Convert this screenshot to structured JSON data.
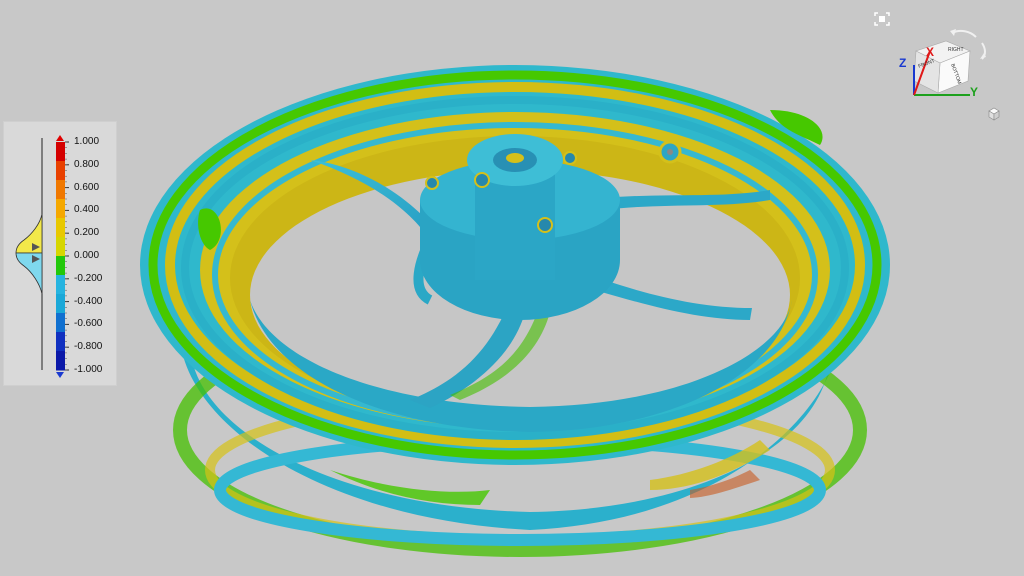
{
  "legend": {
    "labels": [
      "1.000",
      "0.800",
      "0.600",
      "0.400",
      "0.200",
      "0.000",
      "-0.200",
      "-0.400",
      "-0.600",
      "-0.800",
      "-1.000"
    ],
    "colors": [
      "#d40000",
      "#e84000",
      "#f07800",
      "#f5a800",
      "#e8c800",
      "#d6d600",
      "#22c80a",
      "#26b4e0",
      "#1aa8d8",
      "#1070d0",
      "#1030c0",
      "#0a18a8"
    ],
    "upper_limit_arrow_color": "#e00000",
    "lower_limit_arrow_color": "#1a3ad0"
  },
  "navcube": {
    "axis_x": "X",
    "axis_y": "Y",
    "axis_z": "Z",
    "face_right": "RIGHT",
    "face_bottom": "BOTTOM",
    "face_front": "FRONT",
    "axis_x_color": "#e01818",
    "axis_y_color": "#1ca01c",
    "axis_z_color": "#1838d0"
  },
  "model": {
    "name_icon": "wheel-deviation-model"
  }
}
